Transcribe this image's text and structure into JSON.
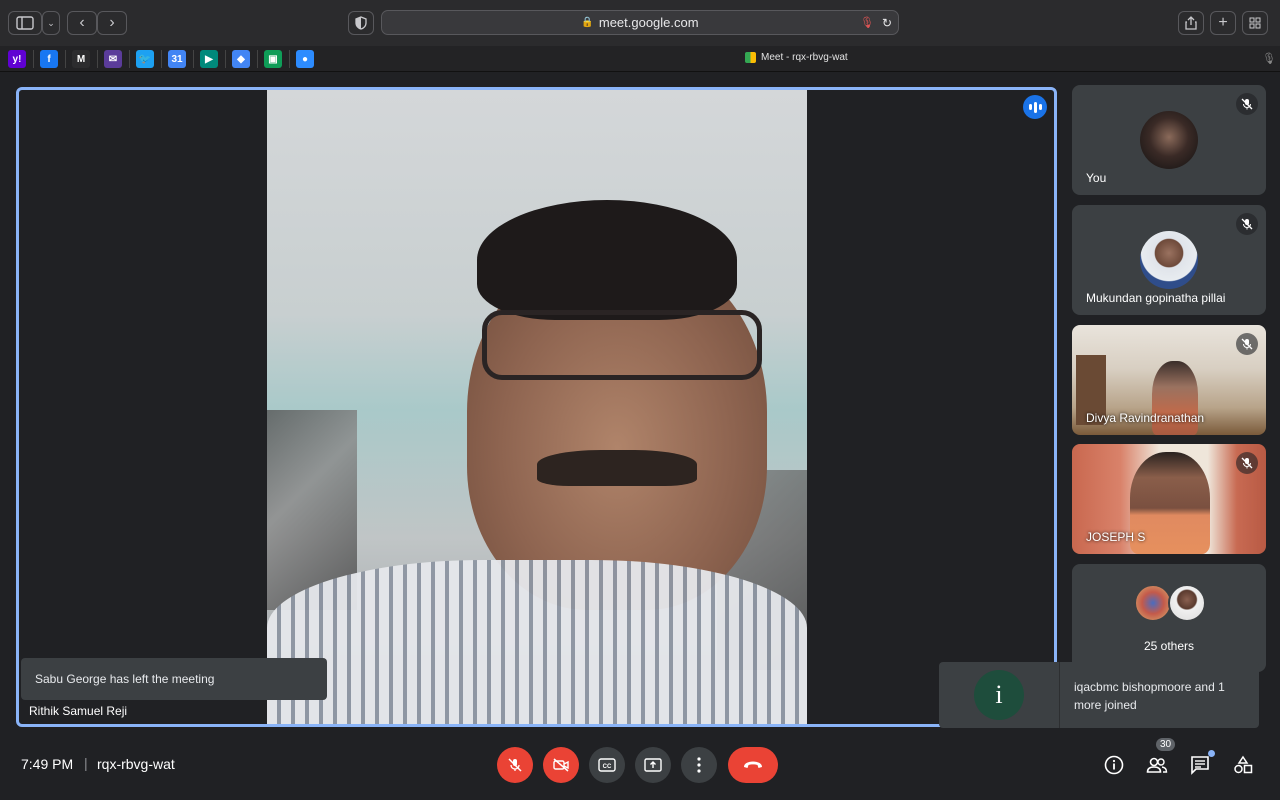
{
  "browser": {
    "url": "meet.google.com",
    "tab_title": "Meet - rqx-rbvg-wat",
    "bookmarks": [
      {
        "icon": "yahoo-icon",
        "letter": "y!",
        "color": "#6001d2"
      },
      {
        "icon": "facebook-icon",
        "letter": "f",
        "color": "#1877f2"
      },
      {
        "icon": "gmail-icon",
        "letter": "M",
        "color": "#2c2c2e"
      },
      {
        "icon": "mail-icon",
        "letter": "✉",
        "color": "#5b3c9a"
      },
      {
        "icon": "twitter-icon",
        "letter": "🐦",
        "color": "#1da1f2"
      },
      {
        "icon": "calendar-icon",
        "letter": "31",
        "color": "#4285f4"
      },
      {
        "icon": "meet-icon",
        "letter": "▶",
        "color": "#00897b"
      },
      {
        "icon": "maps-icon",
        "letter": "◆",
        "color": "#4285f4"
      },
      {
        "icon": "classroom-icon",
        "letter": "▣",
        "color": "#0f9d58"
      },
      {
        "icon": "zoom-icon",
        "letter": "●",
        "color": "#2d8cff"
      }
    ]
  },
  "main": {
    "speaker_name": "Rithik Samuel Reji"
  },
  "participants": [
    {
      "name": "You",
      "type": "avatar",
      "muted": true
    },
    {
      "name": "Mukundan gopinatha pillai",
      "type": "avatar",
      "muted": true
    },
    {
      "name": "Divya Ravindranathan",
      "type": "video",
      "muted": true
    },
    {
      "name": "JOSEPH S",
      "type": "video",
      "muted": true
    }
  ],
  "others": {
    "label": "25 others"
  },
  "notifications": {
    "left_message": "Sabu George has left the meeting",
    "right_icon_letter": "i",
    "right_message": "iqacbmc bishopmoore and 1 more joined"
  },
  "meeting": {
    "time": "7:49 PM",
    "separator": "|",
    "code": "rqx-rbvg-wat",
    "participant_count": "30"
  },
  "colors": {
    "accent": "#8ab4f8",
    "end_call": "#ea4335",
    "bar_bg": "#202124",
    "tile_bg": "#3c4043"
  }
}
